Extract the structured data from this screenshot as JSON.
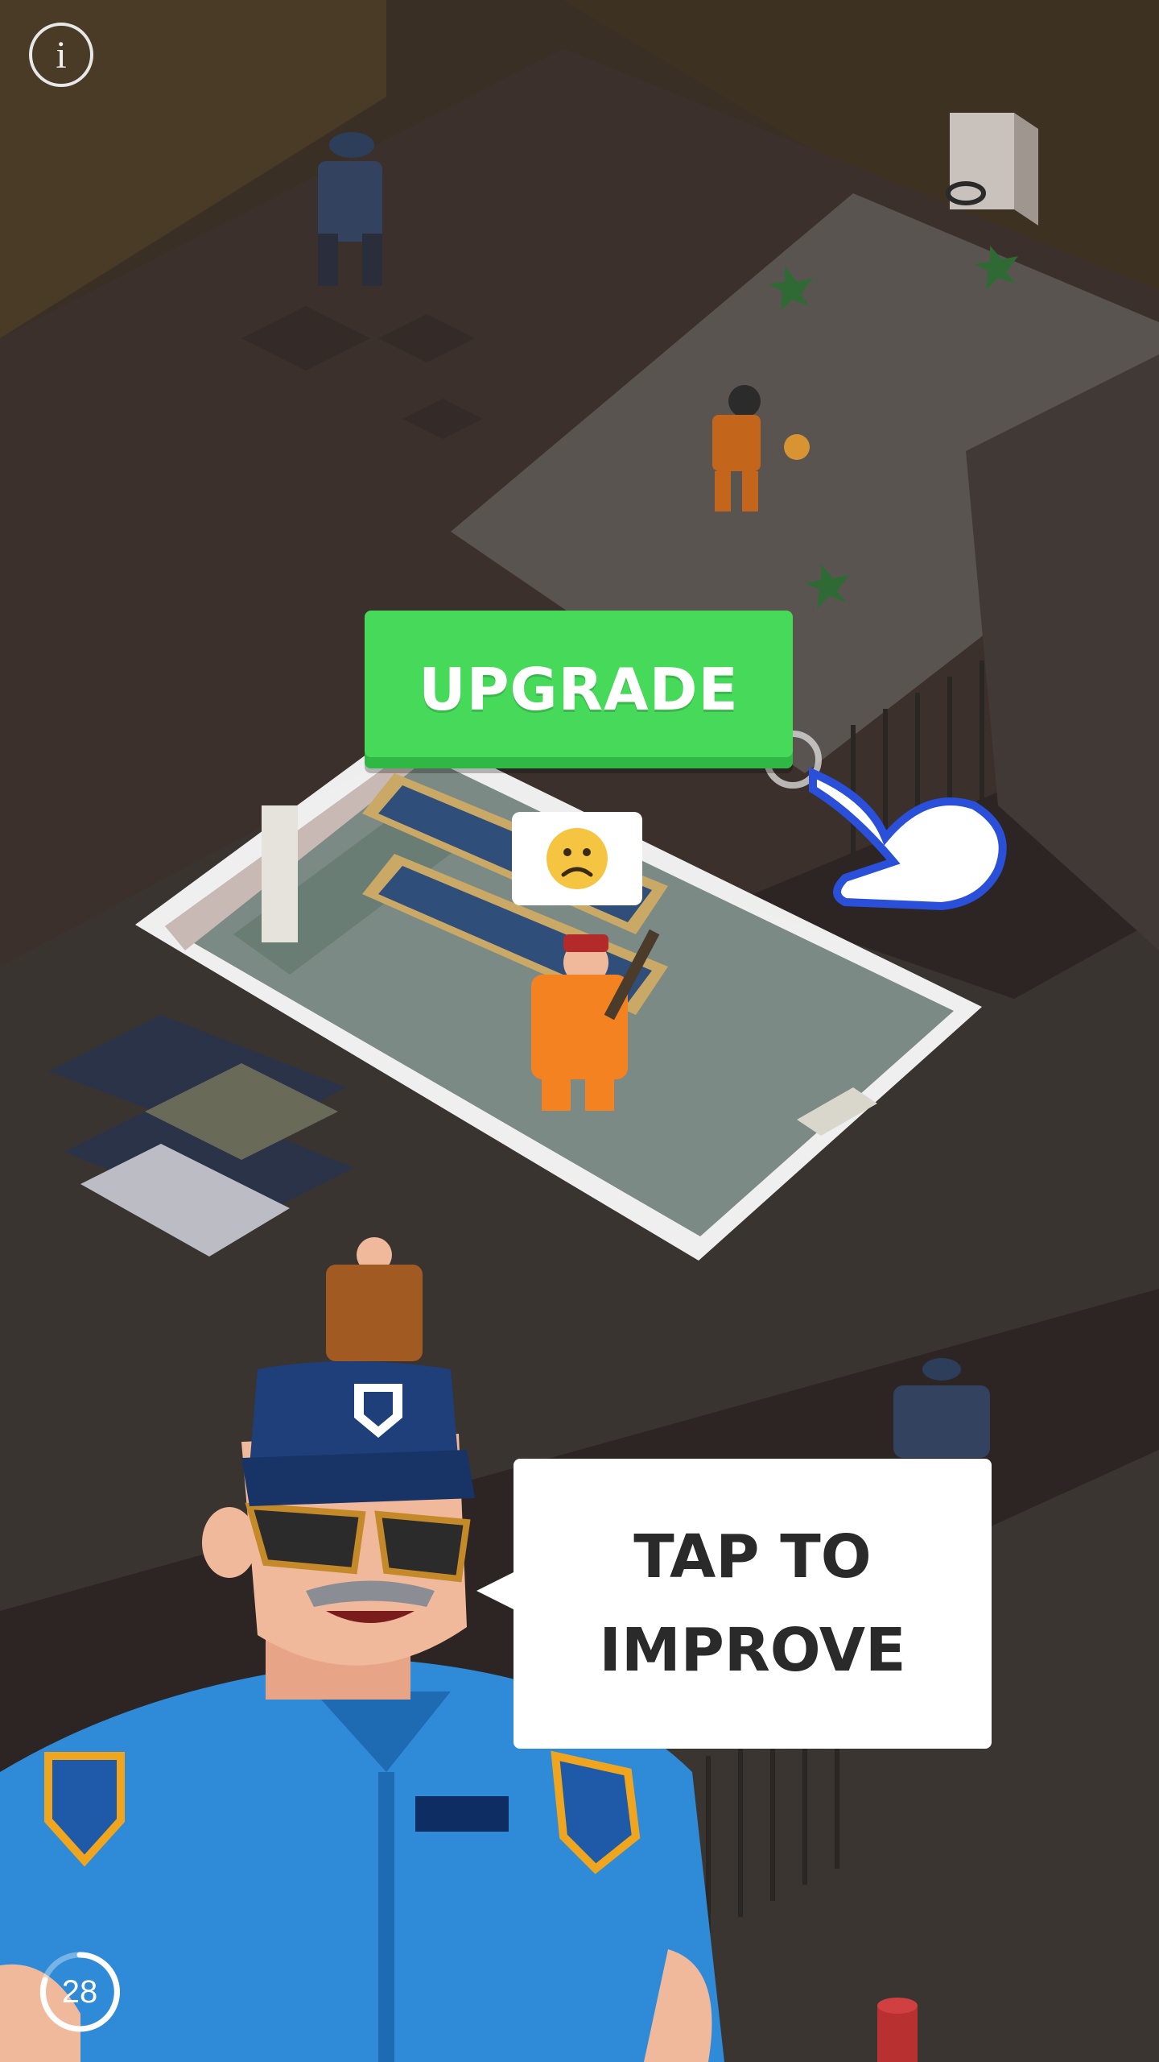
{
  "hud": {
    "info_icon": "info-icon",
    "info_glyph": "i",
    "timer_value": "28"
  },
  "upgrade": {
    "label": "UPGRADE"
  },
  "guard": {
    "speech": "TAP TO\nIMPROVE"
  },
  "colors": {
    "upgrade_green": "#46d95a",
    "hand_blue": "#2a4fd8",
    "prisoner_orange": "#f58220",
    "guard_blue": "#2f8ad8"
  }
}
